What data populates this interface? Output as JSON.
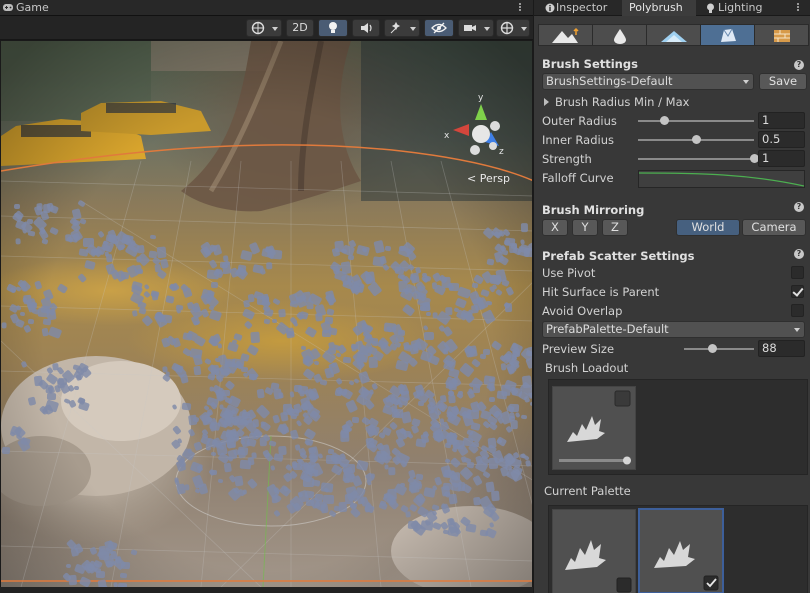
{
  "game_view": {
    "tab_label": "Game",
    "toolbar": {
      "mode_2d_label": "2D"
    },
    "gizmo": {
      "axis_y": "y",
      "axis_x": "x",
      "axis_z": "z",
      "projection_label": "< Persp"
    }
  },
  "tabs": [
    {
      "label": "Inspector",
      "icon": "info-icon"
    },
    {
      "label": "Polybrush",
      "icon": ""
    },
    {
      "label": "Lighting",
      "icon": "bulb-icon"
    }
  ],
  "modes": [
    "raise-lower-icon",
    "smooth-icon",
    "sculpt-icon",
    "scatter-prefab-icon",
    "paint-texture-icon"
  ],
  "brush_settings": {
    "title": "Brush Settings",
    "preset": "BrushSettings-Default",
    "save_label": "Save",
    "radius_foldout": "Brush Radius Min / Max",
    "outer_radius_label": "Outer Radius",
    "outer_radius_value": "1",
    "outer_radius_fraction": 0.22,
    "inner_radius_label": "Inner Radius",
    "inner_radius_value": "0.5",
    "inner_radius_fraction": 0.5,
    "strength_label": "Strength",
    "strength_value": "1",
    "strength_fraction": 1.0,
    "falloff_label": "Falloff Curve",
    "falloff_color": "#4caf50"
  },
  "brush_mirroring": {
    "title": "Brush Mirroring",
    "axes": [
      "X",
      "Y",
      "Z"
    ],
    "spaces": [
      "World",
      "Camera"
    ],
    "selected_space": "World"
  },
  "prefab_scatter": {
    "title": "Prefab Scatter Settings",
    "use_pivot_label": "Use Pivot",
    "use_pivot": false,
    "hit_surface_label": "Hit Surface is Parent",
    "hit_surface": true,
    "avoid_overlap_label": "Avoid Overlap",
    "avoid_overlap": false,
    "palette": "PrefabPalette-Default",
    "preview_size_label": "Preview Size",
    "preview_size_value": "88",
    "preview_size_fraction": 0.4,
    "brush_loadout_label": "Brush Loadout",
    "current_palette_label": "Current Palette"
  },
  "colors": {
    "accent": "#4e6f94",
    "panel": "#383838",
    "scatter": "#7f8aa8"
  }
}
